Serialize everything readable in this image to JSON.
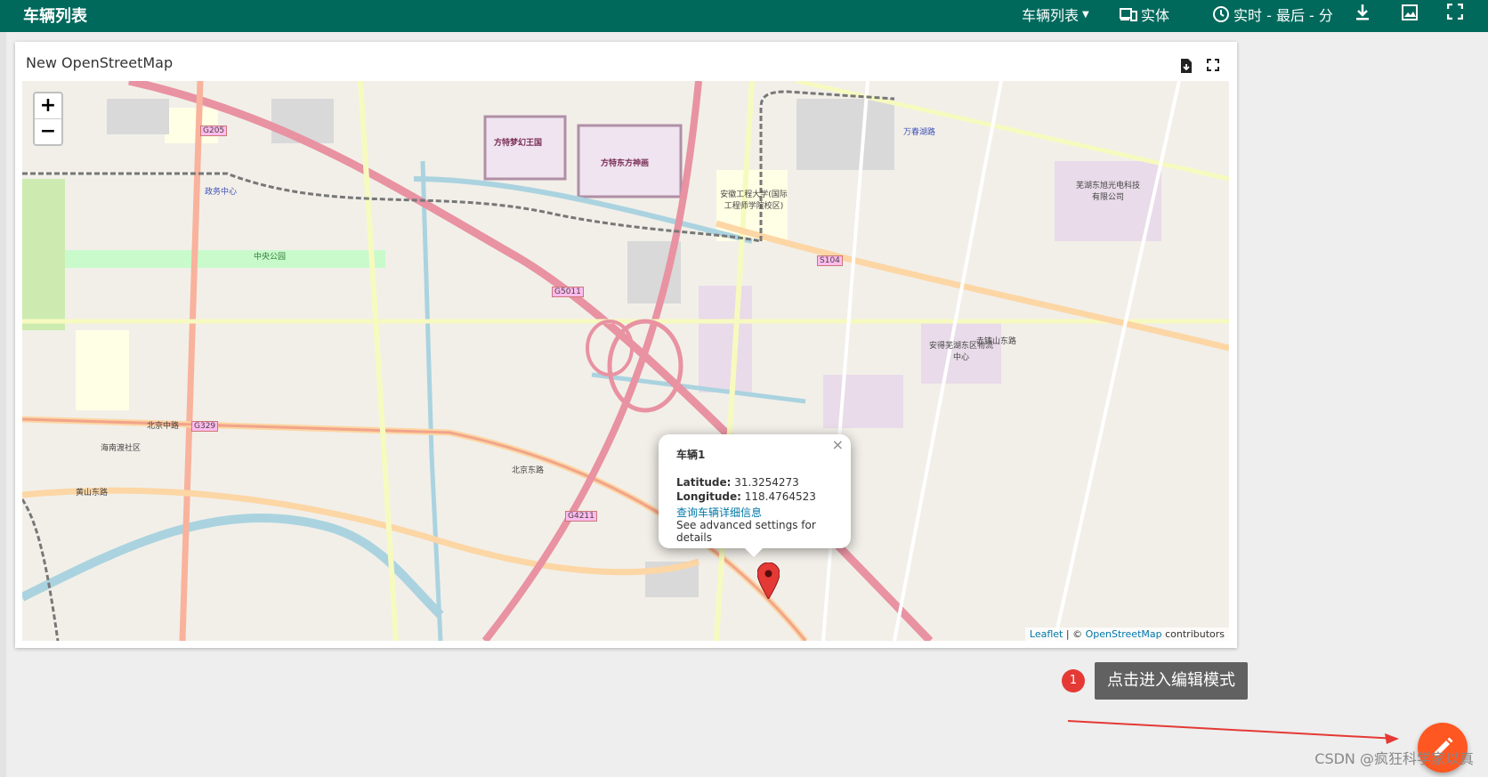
{
  "topbar": {
    "title": "车辆列表",
    "entity_list_label": "车辆列表",
    "entity_label": "实体",
    "timewindow_label": "实时 - 最后 - 分"
  },
  "widget": {
    "title": "New OpenStreetMap"
  },
  "map": {
    "zoom_in": "+",
    "zoom_out": "−",
    "labels": [
      {
        "text": "方特梦幻王国"
      },
      {
        "text": "方特东方神画"
      },
      {
        "text": "安徽工程大学(国际工程师学院校区)"
      },
      {
        "text": "赤铸山东路"
      },
      {
        "text": "北京中路"
      },
      {
        "text": "北京东路"
      },
      {
        "text": "黄山东路"
      },
      {
        "text": "中央公园"
      },
      {
        "text": "芜湖东旭光电科技有限公司"
      },
      {
        "text": "安得芜湖东区物流中心"
      },
      {
        "text": "万春湖路"
      },
      {
        "text": "政务中心"
      },
      {
        "text": "海南渡社区"
      },
      {
        "text": "G205"
      },
      {
        "text": "G329"
      },
      {
        "text": "G4211"
      },
      {
        "text": "G5011"
      },
      {
        "text": "S104"
      }
    ],
    "attribution": {
      "leaflet": "Leaflet",
      "sep": " | © ",
      "osm": "OpenStreetMap",
      "suffix": " contributors"
    }
  },
  "popup": {
    "title": "车辆1",
    "lat_label": "Latitude:",
    "lat_value": "31.3254273",
    "lon_label": "Longitude:",
    "lon_value": "118.4764523",
    "link": "查询车辆详细信息",
    "note": "See advanced settings for details",
    "close": "×"
  },
  "annotation": {
    "step": "1",
    "tooltip": "点击进入编辑模式"
  },
  "watermark": "CSDN @疯狂科学家以真",
  "colors": {
    "primary": "#00695c",
    "fab": "#ff5722",
    "badge": "#e53935"
  }
}
